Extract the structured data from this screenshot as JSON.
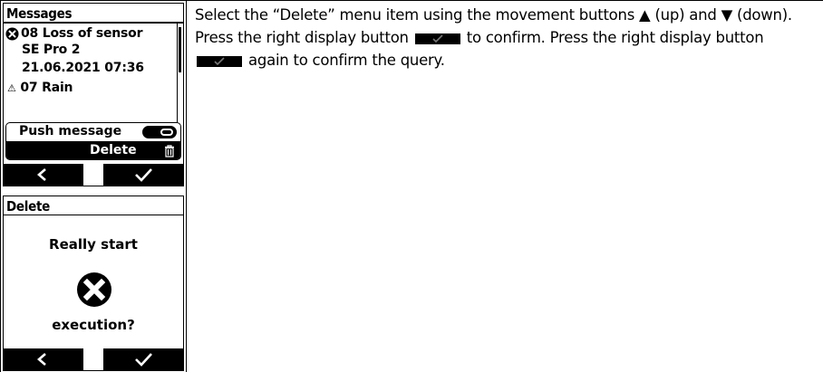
{
  "screen_messages": {
    "title": "Messages",
    "message_line1": "08 Loss of sensor",
    "message_line2": "SE Pro 2",
    "message_line3": "21.06.2021 07:36",
    "next_message_partial": "07 Rain",
    "menu": {
      "item_push": "Push message",
      "item_delete": "Delete"
    }
  },
  "screen_delete": {
    "title": "Delete",
    "line1": "Really start",
    "line2": "execution?"
  },
  "instruction": {
    "part1": "Select the “Delete” menu item using the movement buttons ▲ (up) and ▼ (down). Press the right display button",
    "part2": "to confirm. Press the right display button",
    "part3": "again to confirm the query."
  }
}
